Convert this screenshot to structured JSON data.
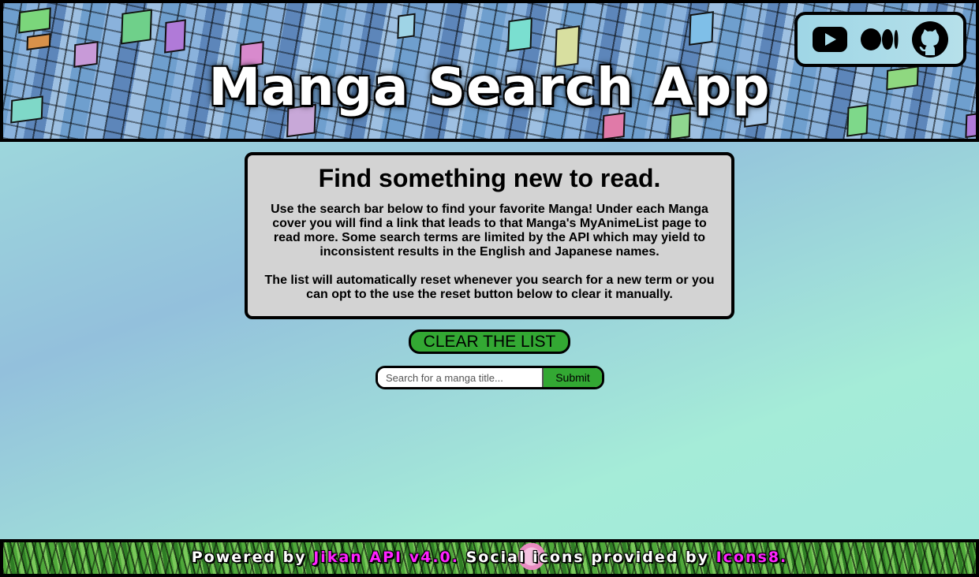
{
  "header": {
    "title": "Manga Search App",
    "social": [
      {
        "name": "youtube-icon"
      },
      {
        "name": "medium-icon"
      },
      {
        "name": "github-icon"
      }
    ]
  },
  "info": {
    "heading": "Find something new to read.",
    "paragraph1": "Use the search bar below to find your favorite Manga! Under each Manga cover you will find a link that leads to that Manga's MyAnimeList page to read more. Some search terms are limited by the API which may yield to inconsistent results in the English and Japanese names.",
    "paragraph2": "The list will automatically reset whenever you search for a new term or you can opt to the use the reset button below to clear it manually."
  },
  "clear_button": {
    "label": "CLEAR THE LIST"
  },
  "search": {
    "placeholder": "Search for a manga title...",
    "value": "",
    "submit_label": "Submit"
  },
  "footer": {
    "powered_prefix": "Powered by ",
    "jikan_link": "Jikan API v4.0.",
    "icons_text": " Social icons provided by ",
    "icons8_link": "Icons8."
  },
  "colors": {
    "accent_green": "#33a833",
    "card_gray": "#d3d3d3",
    "link_magenta": "#ff22ff"
  }
}
